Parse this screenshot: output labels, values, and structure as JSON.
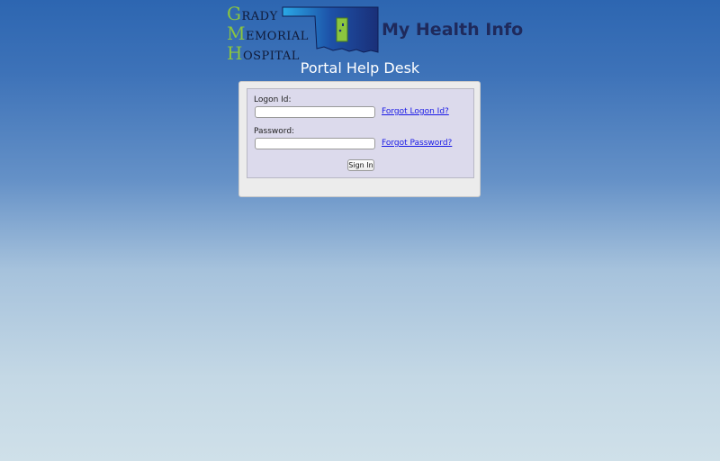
{
  "header": {
    "logo": {
      "line1_initial": "G",
      "line1_rest": "RADY",
      "line2_initial": "M",
      "line2_rest": "EMORIAL",
      "line3_initial": "H",
      "line3_rest": "OSPITAL",
      "brand": "My Health Info",
      "icon": "oklahoma-state-map-icon",
      "initial_color": "#8bc53f",
      "map_color": "#1f3a8a"
    },
    "title": "Portal Help Desk"
  },
  "login": {
    "logon_label": "Logon Id:",
    "logon_value": "",
    "password_label": "Password:",
    "password_value": "",
    "forgot_logon": "Forgot Logon Id?",
    "forgot_password": "Forgot Password?",
    "sign_in": "Sign In"
  }
}
